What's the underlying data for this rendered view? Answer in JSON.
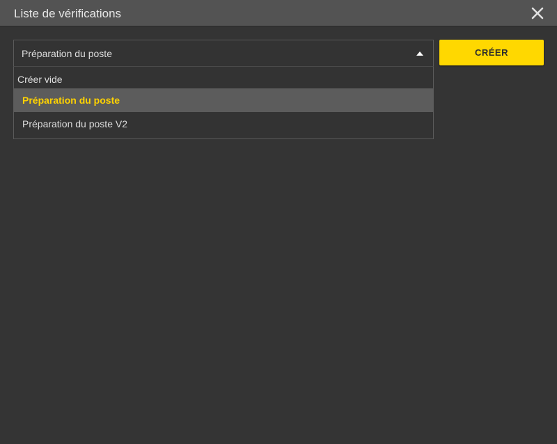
{
  "dialog": {
    "title": "Liste de vérifications",
    "close_icon": "close-icon"
  },
  "select": {
    "value": "Préparation du poste",
    "caret_icon": "caret-up-icon"
  },
  "dropdown": {
    "group_label": "Créer vide",
    "options": [
      {
        "label": "Préparation du poste",
        "selected": true
      },
      {
        "label": "Préparation du poste V2",
        "selected": false
      }
    ]
  },
  "actions": {
    "create_label": "CRÉER"
  },
  "colors": {
    "accent": "#ffd800",
    "background": "#343434",
    "titlebar": "#535353",
    "selected_row": "#5c5c5c"
  }
}
